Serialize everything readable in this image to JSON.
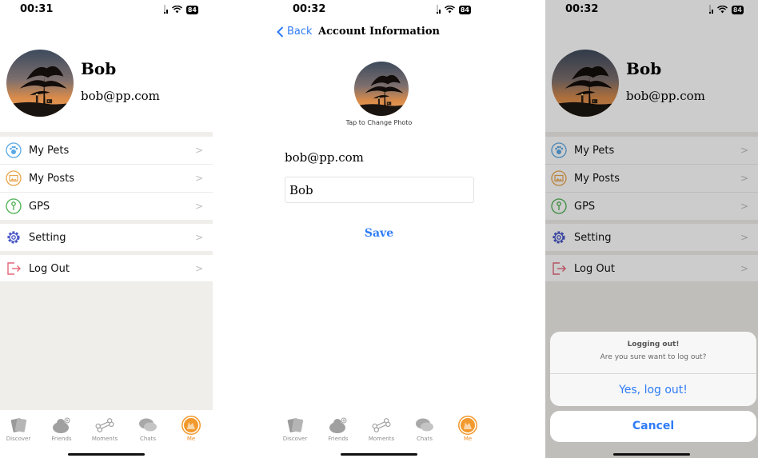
{
  "status": {
    "time1": "00:31",
    "time2": "00:32",
    "time3": "00:32",
    "battery": "84"
  },
  "profile": {
    "name": "Bob",
    "email": "bob@pp.com"
  },
  "menu": [
    {
      "label": "My Pets",
      "icon": "paw-icon"
    },
    {
      "label": "My Posts",
      "icon": "image-icon"
    },
    {
      "label": "GPS",
      "icon": "pin-icon"
    },
    {
      "label": "Setting",
      "icon": "gear-icon"
    },
    {
      "label": "Log Out",
      "icon": "logout-icon"
    }
  ],
  "tabs": [
    {
      "label": "Discover",
      "icon": "cards-icon"
    },
    {
      "label": "Friends",
      "icon": "friends-icon"
    },
    {
      "label": "Moments",
      "icon": "bone-icon"
    },
    {
      "label": "Chats",
      "icon": "chat-bubbles-icon"
    },
    {
      "label": "Me",
      "icon": "dog-avatar-icon"
    }
  ],
  "account": {
    "back": "Back",
    "title": "Account Information",
    "tap_photo": "Tap to Change Photo",
    "email": "bob@pp.com",
    "name_value": "Bob",
    "save": "Save"
  },
  "alert": {
    "title": "Logging out!",
    "message": "Are you sure want to log out?",
    "confirm": "Yes, log out!",
    "cancel": "Cancel"
  },
  "colors": {
    "accent": "#2f7cf6",
    "active_tab": "#ef8d27",
    "gap": "#efeeea"
  }
}
